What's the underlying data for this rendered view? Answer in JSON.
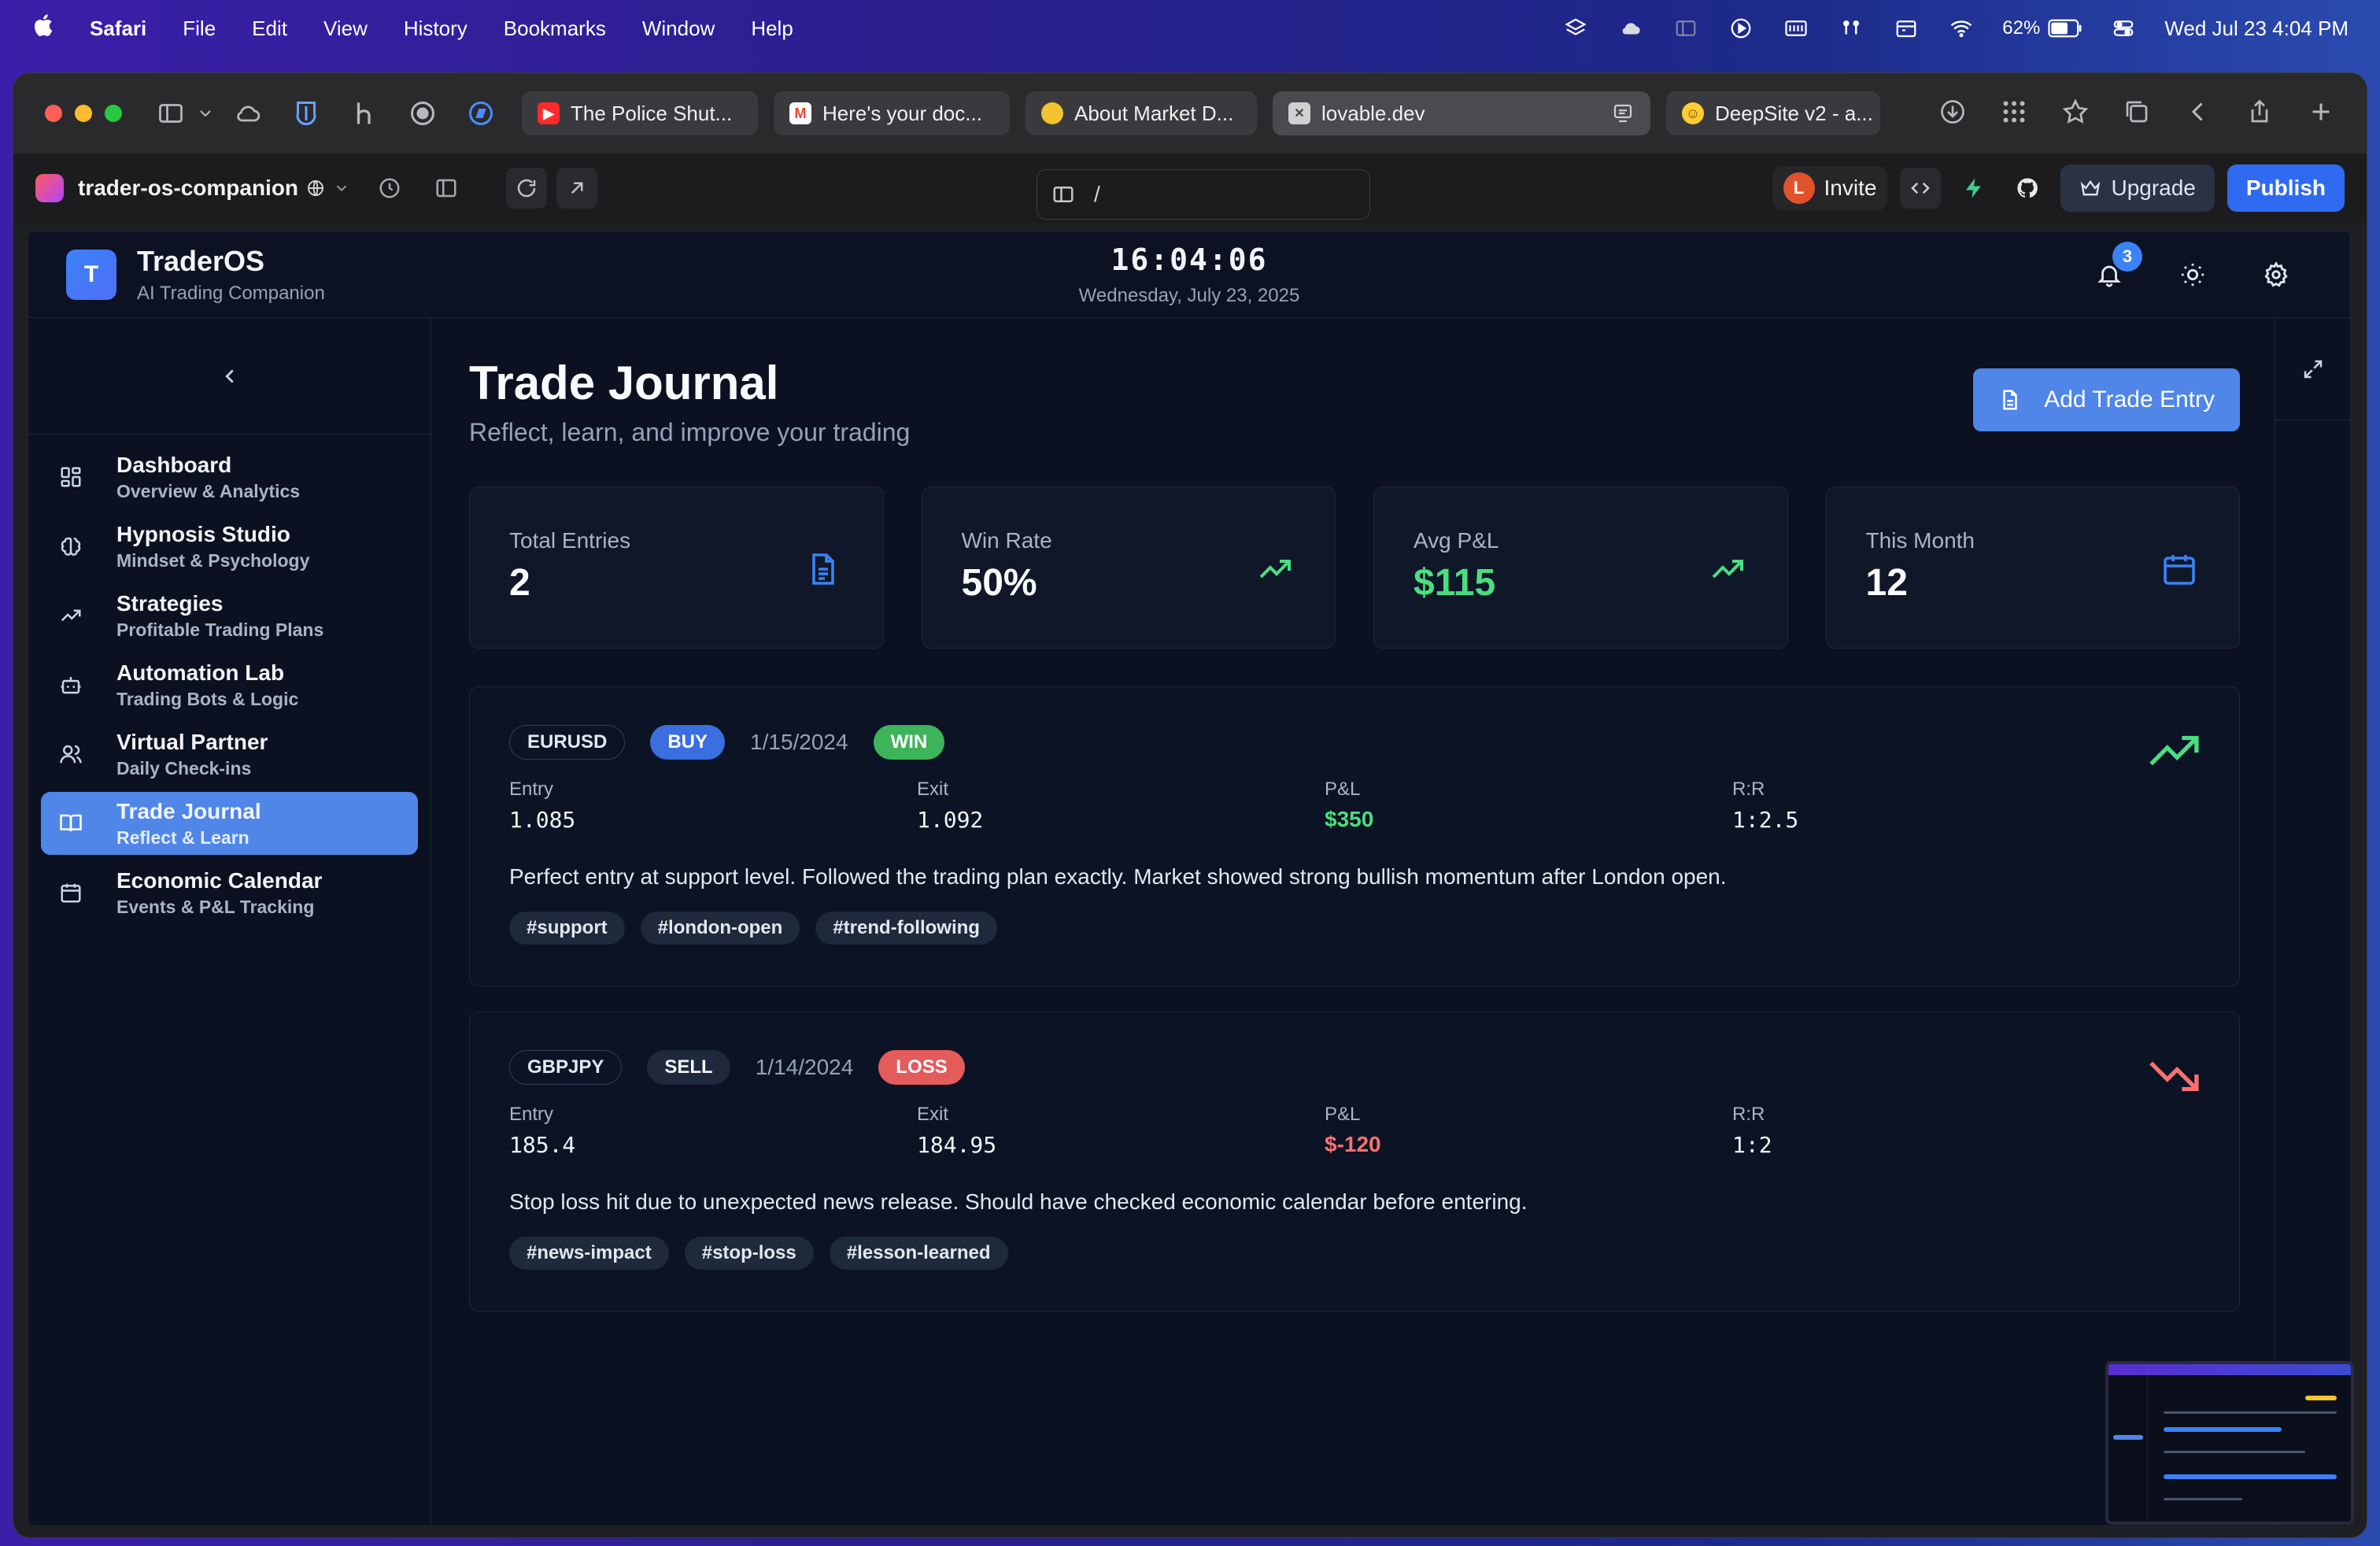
{
  "menubar": {
    "app_name": "Safari",
    "items": [
      "File",
      "Edit",
      "View",
      "History",
      "Bookmarks",
      "Window",
      "Help"
    ],
    "battery": "62%",
    "datetime": "Wed Jul 23  4:04 PM"
  },
  "browser": {
    "tabs": [
      {
        "label": "The Police Shut...",
        "favicon": "youtube-icon",
        "color": "#ff2b2b"
      },
      {
        "label": "Here's your doc...",
        "favicon": "gmail-icon",
        "color": "#ea4335"
      },
      {
        "label": "About Market D...",
        "favicon": "coin-icon",
        "color": "#f4c430"
      },
      {
        "label": "lovable.dev",
        "favicon": "close-icon",
        "color": "#666666"
      },
      {
        "label": "DeepSite v2 - a...",
        "favicon": "hugging-face-icon",
        "color": "#ffcc33"
      }
    ]
  },
  "lovable": {
    "project": "trader-os-companion",
    "url_path": "/",
    "invite_label": "Invite",
    "invite_avatar": "L",
    "upgrade_label": "Upgrade",
    "publish_label": "Publish"
  },
  "app": {
    "brand_initial": "T",
    "brand_title": "TraderOS",
    "brand_sub": "AI Trading Companion",
    "time": "16:04:06",
    "date": "Wednesday, July 23, 2025",
    "notification_count": "3",
    "nav": [
      {
        "label": "Dashboard",
        "sub": "Overview & Analytics",
        "icon": "grid-icon"
      },
      {
        "label": "Hypnosis Studio",
        "sub": "Mindset & Psychology",
        "icon": "brain-icon"
      },
      {
        "label": "Strategies",
        "sub": "Profitable Trading Plans",
        "icon": "trending-up-icon"
      },
      {
        "label": "Automation Lab",
        "sub": "Trading Bots & Logic",
        "icon": "bot-icon"
      },
      {
        "label": "Virtual Partner",
        "sub": "Daily Check-ins",
        "icon": "users-icon"
      },
      {
        "label": "Trade Journal",
        "sub": "Reflect & Learn",
        "icon": "book-icon",
        "active": true
      },
      {
        "label": "Economic Calendar",
        "sub": "Events & P&L Tracking",
        "icon": "calendar-icon"
      }
    ],
    "page": {
      "title": "Trade Journal",
      "subtitle": "Reflect, learn, and improve your trading",
      "add_button": "Add Trade Entry"
    },
    "stats": [
      {
        "label": "Total Entries",
        "value": "2",
        "icon": "file-icon",
        "color": "#3b82f6"
      },
      {
        "label": "Win Rate",
        "value": "50%",
        "icon": "trending-up-icon",
        "color": "#4ade80"
      },
      {
        "label": "Avg P&L",
        "value": "$115",
        "icon": "trending-up-icon",
        "color": "#4ade80"
      },
      {
        "label": "This Month",
        "value": "12",
        "icon": "calendar-icon",
        "color": "#3b82f6"
      }
    ],
    "entries": [
      {
        "pair": "EURUSD",
        "side": "BUY",
        "date": "1/15/2024",
        "result": "WIN",
        "entry_label": "Entry",
        "entry": "1.085",
        "exit_label": "Exit",
        "exit": "1.092",
        "pnl_label": "P&L",
        "pnl": "$350",
        "rr_label": "R:R",
        "rr": "1:2.5",
        "note": "Perfect entry at support level. Followed the trading plan exactly. Market showed strong bullish momentum after London open.",
        "tags": [
          "#support",
          "#london-open",
          "#trend-following"
        ]
      },
      {
        "pair": "GBPJPY",
        "side": "SELL",
        "date": "1/14/2024",
        "result": "LOSS",
        "entry_label": "Entry",
        "entry": "185.4",
        "exit_label": "Exit",
        "exit": "184.95",
        "pnl_label": "P&L",
        "pnl": "$-120",
        "rr_label": "R:R",
        "rr": "1:2",
        "note": "Stop loss hit due to unexpected news release. Should have checked economic calendar before entering.",
        "tags": [
          "#news-impact",
          "#stop-loss",
          "#lesson-learned"
        ]
      }
    ]
  },
  "colors": {
    "accent": "#4f86e8",
    "win": "#3db45a",
    "loss": "#e45b5b",
    "background": "#0b1120"
  }
}
